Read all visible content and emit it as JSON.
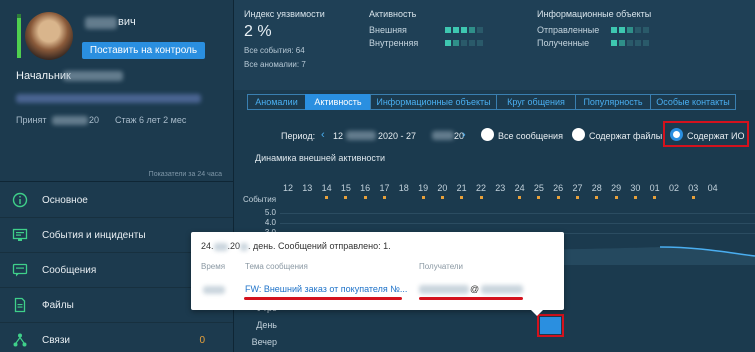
{
  "user": {
    "name_suffix": "вич",
    "control_button": "Поставить на контроль",
    "position_label": "Начальник",
    "hired_label": "Принят",
    "hired_year": "20",
    "tenure": "Стаж 6 лет 2 мес"
  },
  "sidebar": {
    "period_note": "Показатели за 24 часа",
    "items": [
      {
        "label": "Основное",
        "icon": "info-circle-icon",
        "count": ""
      },
      {
        "label": "События и инциденты",
        "icon": "monitor-alert-icon",
        "count": ""
      },
      {
        "label": "Сообщения",
        "icon": "message-icon",
        "count": ""
      },
      {
        "label": "Файлы",
        "icon": "file-icon",
        "count": ""
      },
      {
        "label": "Связи",
        "icon": "network-icon",
        "count": "0"
      }
    ]
  },
  "stats": {
    "vulnerability_title": "Индекс уязвимости",
    "vulnerability_value": "2 %",
    "events_label": "Все события: 64",
    "anomalies_label": "Все аномалии: 7",
    "activity_title": "Активность",
    "activity_external": "Внешняя",
    "activity_internal": "Внутренняя",
    "activity_external_level": 4,
    "activity_internal_level": 2,
    "info_objects_title": "Информационные объекты",
    "info_sent": "Отправленные",
    "info_received": "Полученные",
    "info_sent_level": 3,
    "info_received_level": 2
  },
  "tabs": [
    {
      "label": "Аномалии",
      "active": false
    },
    {
      "label": "Активность",
      "active": true
    },
    {
      "label": "Информационные объекты",
      "active": false
    },
    {
      "label": "Круг общения",
      "active": false
    },
    {
      "label": "Популярность",
      "active": false
    },
    {
      "label": "Особые контакты",
      "active": false
    }
  ],
  "period": {
    "label": "Период:",
    "start_day": "12",
    "middle": "2020 - 27",
    "end_year": "20",
    "options": [
      {
        "label": "Все сообщения",
        "checked": false
      },
      {
        "label": "Содержат файлы",
        "checked": false
      },
      {
        "label": "Содержат ИО",
        "checked": true
      }
    ]
  },
  "chart": {
    "title": "Динамика внешней активности",
    "events_axis_label": "События",
    "hours": [
      "12",
      "13",
      "14",
      "15",
      "16",
      "17",
      "18",
      "19",
      "20",
      "21",
      "22",
      "23",
      "24",
      "25",
      "26",
      "27",
      "28",
      "29",
      "30",
      "01",
      "02",
      "03",
      "04"
    ],
    "event_marks": [
      "14",
      "15",
      "16",
      "17",
      "19",
      "20",
      "21",
      "22",
      "24",
      "25",
      "26",
      "27",
      "28",
      "29",
      "30",
      "01",
      "03"
    ],
    "y_ticks": [
      "5.0",
      "4.0",
      "3.0"
    ],
    "day_parts": [
      "Утро",
      "День",
      "Вечер"
    ],
    "highlighted_cell": {
      "date": "24",
      "day_part": "День"
    }
  },
  "tooltip": {
    "header_prefix": "24.",
    "header_mid": ".20",
    "header_suffix": ". день. Сообщений отправлено: 1.",
    "col_time": "Время",
    "col_subject": "Тема сообщения",
    "col_recipients": "Получатели",
    "subject": "FW: Внешний заказ от покупателя №...",
    "recipient_at": "@"
  },
  "colors": {
    "accent": "#2a8fe0",
    "highlight_red": "#d4121d",
    "activity_on": "#3ec7b0",
    "event_mark": "#e8a13a"
  }
}
